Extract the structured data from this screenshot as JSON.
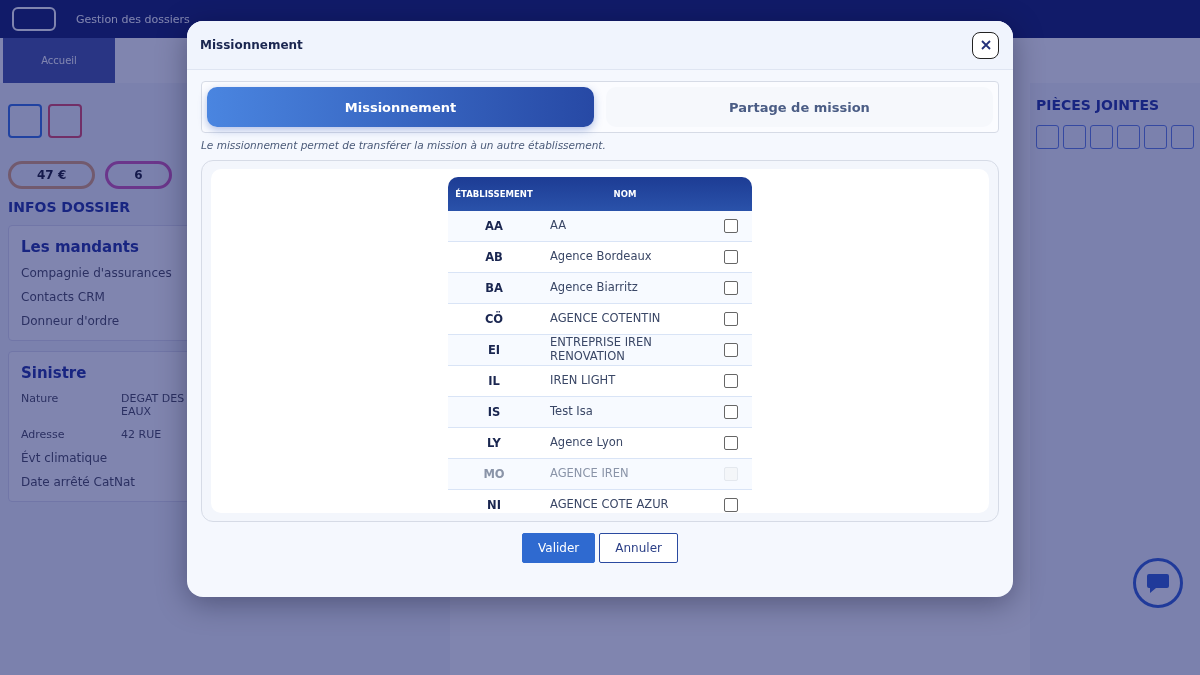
{
  "app": {
    "nav": [
      "Gestion des dossiers"
    ],
    "tab": "Accueil",
    "badges": [
      {
        "text": "47 €",
        "kind": "amount"
      },
      {
        "text": "6",
        "kind": "count"
      }
    ],
    "section_title": "INFOS DOSSIER",
    "mandants": {
      "title": "Les mandants",
      "items": [
        "Compagnie d'assurances",
        "Contacts CRM",
        "Donneur d'ordre"
      ]
    },
    "sinistre": {
      "title": "Sinistre",
      "fields": [
        {
          "label": "Nature",
          "value": "DEGAT DES EAUX"
        },
        {
          "label": "Adresse",
          "value": "42 RUE"
        }
      ],
      "extra_labels": [
        "Évt climatique",
        "Date arrêté CatNat"
      ]
    },
    "attachments_title": "PIÈCES JOINTES"
  },
  "dialog": {
    "title": "Missionnement",
    "tabs": [
      {
        "label": "Missionnement",
        "selected": true
      },
      {
        "label": "Partage de mission",
        "selected": false
      }
    ],
    "description": "Le missionnement permet de transférer la mission à un autre établissement.",
    "table": {
      "columns": [
        "ÉTABLISSEMENT",
        "NOM"
      ],
      "rows": [
        {
          "code": "AA",
          "name": "AA",
          "checked": false,
          "disabled": false
        },
        {
          "code": "AB",
          "name": "Agence Bordeaux",
          "checked": false,
          "disabled": false
        },
        {
          "code": "BA",
          "name": "Agence Biarritz",
          "checked": false,
          "disabled": false
        },
        {
          "code": "CÖ",
          "name": "AGENCE COTENTIN",
          "checked": false,
          "disabled": false
        },
        {
          "code": "EI",
          "name": "ENTREPRISE IREN RENOVATION",
          "checked": false,
          "disabled": false
        },
        {
          "code": "IL",
          "name": "IREN LIGHT",
          "checked": false,
          "disabled": false
        },
        {
          "code": "IS",
          "name": "Test Isa",
          "checked": false,
          "disabled": false
        },
        {
          "code": "LY",
          "name": "Agence Lyon",
          "checked": false,
          "disabled": false
        },
        {
          "code": "MO",
          "name": "AGENCE IREN",
          "checked": false,
          "disabled": true
        },
        {
          "code": "NI",
          "name": "AGENCE COTE AZUR",
          "checked": false,
          "disabled": false
        }
      ]
    },
    "buttons": [
      {
        "label": "Valider",
        "kind": "primary"
      },
      {
        "label": "Annuler",
        "kind": "secondary"
      }
    ]
  }
}
